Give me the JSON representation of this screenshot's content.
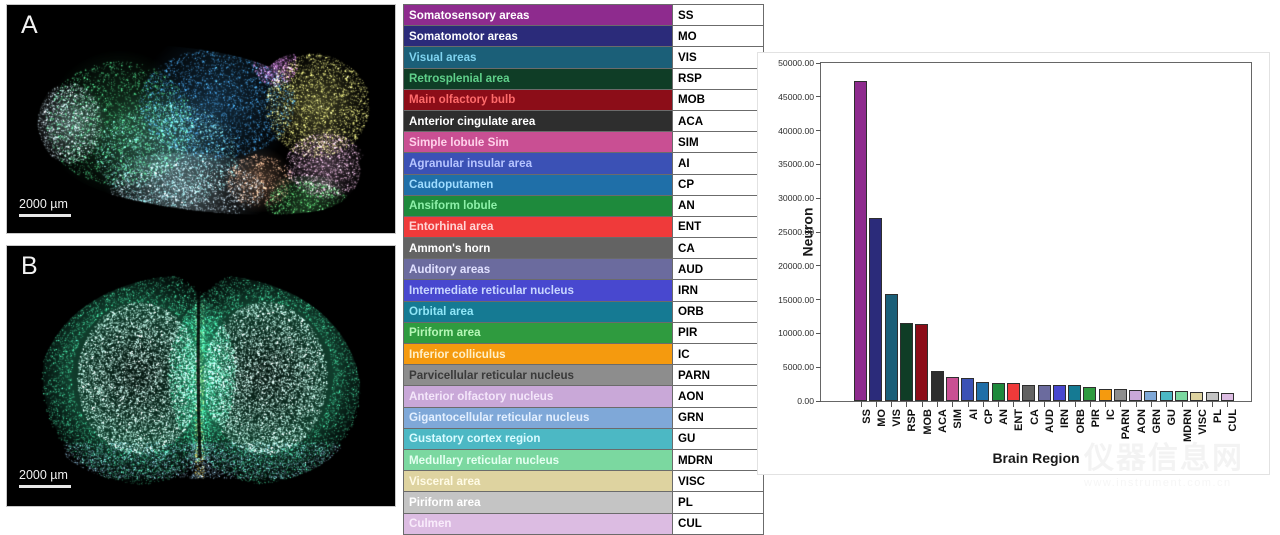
{
  "panels": {
    "a": {
      "letter": "A",
      "scalebar_label": "2000 µm"
    },
    "b": {
      "letter": "B",
      "scalebar_label": "2000 µm"
    }
  },
  "legend_table": {
    "rows": [
      {
        "name": "Somatosensory areas",
        "abbr": "SS",
        "bg": "#8e2b8e",
        "fg": "#ffffff"
      },
      {
        "name": "Somatomotor areas",
        "abbr": "MO",
        "bg": "#2b2b7a",
        "fg": "#ffffff"
      },
      {
        "name": "Visual areas",
        "abbr": "VIS",
        "bg": "#1b5f78",
        "fg": "#7fd4f0"
      },
      {
        "name": "Retrosplenial area",
        "abbr": "RSP",
        "bg": "#0f3d26",
        "fg": "#5fd08a"
      },
      {
        "name": "Main olfactory bulb",
        "abbr": "MOB",
        "bg": "#8c0d18",
        "fg": "#ff6b6b"
      },
      {
        "name": "Anterior cingulate area",
        "abbr": "ACA",
        "bg": "#2e2e2e",
        "fg": "#ffffff"
      },
      {
        "name": "Simple lobule Sim",
        "abbr": "SIM",
        "bg": "#c94f93",
        "fg": "#ffd1ea"
      },
      {
        "name": "Agranular insular area",
        "abbr": "AI",
        "bg": "#3b51b5",
        "fg": "#b6c4ff"
      },
      {
        "name": "Caudoputamen",
        "abbr": "CP",
        "bg": "#1f6fa8",
        "fg": "#9fdcff"
      },
      {
        "name": "Ansiform lobule",
        "abbr": "AN",
        "bg": "#1e8a3c",
        "fg": "#8df0a8"
      },
      {
        "name": "Entorhinal area",
        "abbr": "ENT",
        "bg": "#ef3a3a",
        "fg": "#ffd6d6"
      },
      {
        "name": "Ammon's horn",
        "abbr": "CA",
        "bg": "#636363",
        "fg": "#ffffff"
      },
      {
        "name": "Auditory areas",
        "abbr": "AUD",
        "bg": "#6b6b9e",
        "fg": "#e0e0ff"
      },
      {
        "name": "Intermediate reticular nucleus",
        "abbr": "IRN",
        "bg": "#4848cf",
        "fg": "#c8d6ff"
      },
      {
        "name": "Orbital area",
        "abbr": "ORB",
        "bg": "#157a93",
        "fg": "#8fe6f7"
      },
      {
        "name": "Piriform area",
        "abbr": "PIR",
        "bg": "#2f9b3f",
        "fg": "#b6f7b6"
      },
      {
        "name": "Inferior colliculus",
        "abbr": "IC",
        "bg": "#f59a0e",
        "fg": "#fff0c8"
      },
      {
        "name": "Parvicellular reticular nucleus",
        "abbr": "PARN",
        "bg": "#8d8d8d",
        "fg": "#3a3a3a"
      },
      {
        "name": "Anterior olfactory nucleus",
        "abbr": "AON",
        "bg": "#c9a8d8",
        "fg": "#f4e6fa"
      },
      {
        "name": "Gigantocellular reticular nucleus",
        "abbr": "GRN",
        "bg": "#7fa8d8",
        "fg": "#e3efff"
      },
      {
        "name": "Gustatory cortex region",
        "abbr": "GU",
        "bg": "#4cb8c4",
        "fg": "#d8fbff"
      },
      {
        "name": "Medullary reticular nucleus",
        "abbr": "MDRN",
        "bg": "#7bd8a0",
        "fg": "#e4fff0"
      },
      {
        "name": "Visceral area",
        "abbr": "VISC",
        "bg": "#ded3a0",
        "fg": "#fffbe6"
      },
      {
        "name": "Piriform area",
        "abbr": "PL",
        "bg": "#c4c4c4",
        "fg": "#ffffff"
      },
      {
        "name": "Culmen",
        "abbr": "CUL",
        "bg": "#dcbce2",
        "fg": "#f9ecfb"
      }
    ]
  },
  "chart_data": {
    "type": "bar",
    "title": "",
    "xlabel": "Brain Region",
    "ylabel": "Neuron",
    "ylim": [
      0,
      50000
    ],
    "ytick_labels": [
      "0.00",
      "5000.00",
      "10000.00",
      "15000.00",
      "20000.00",
      "25000.00",
      "30000.00",
      "35000.00",
      "40000.00",
      "45000.00",
      "50000.00"
    ],
    "ytick_values": [
      0,
      5000,
      10000,
      15000,
      20000,
      25000,
      30000,
      35000,
      40000,
      45000,
      50000
    ],
    "grid": false,
    "legend": "none",
    "categories": [
      "SS",
      "MO",
      "VIS",
      "RSP",
      "MOB",
      "ACA",
      "SIM",
      "AI",
      "CP",
      "AN",
      "ENT",
      "CA",
      "AUD",
      "IRN",
      "ORB",
      "PIR",
      "IC",
      "PARN",
      "AON",
      "GRN",
      "GU",
      "MDRN",
      "VISC",
      "PL",
      "CUL"
    ],
    "values": [
      47400,
      27000,
      15800,
      11500,
      11400,
      4400,
      3500,
      3350,
      2800,
      2700,
      2650,
      2400,
      2350,
      2300,
      2300,
      2000,
      1850,
      1750,
      1700,
      1550,
      1500,
      1450,
      1350,
      1300,
      1250
    ],
    "bar_colors": [
      "#8e2b8e",
      "#2b2b7a",
      "#1b5f78",
      "#0f3d26",
      "#8c0d18",
      "#2e2e2e",
      "#c94f93",
      "#3b51b5",
      "#1f6fa8",
      "#1e8a3c",
      "#ef3a3a",
      "#636363",
      "#6b6b9e",
      "#4848cf",
      "#157a93",
      "#2f9b3f",
      "#f59a0e",
      "#8d8d8d",
      "#c9a8d8",
      "#7fa8d8",
      "#4cb8c4",
      "#7bd8a0",
      "#ded3a0",
      "#c4c4c4",
      "#dcbce2"
    ]
  },
  "watermark": {
    "text_cn": "仪器信息网",
    "text_url": "www.instrument.com.cn"
  }
}
